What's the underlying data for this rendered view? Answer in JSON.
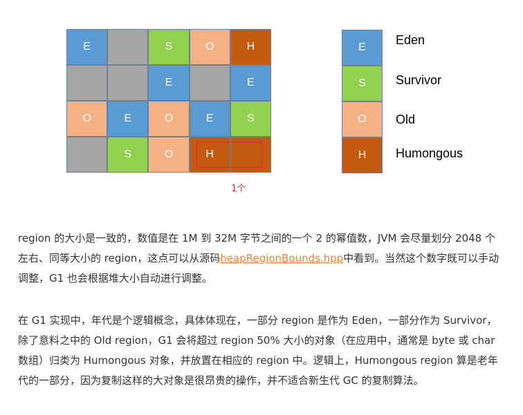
{
  "grid": {
    "rows": [
      [
        "E",
        "",
        "S",
        "O",
        "H"
      ],
      [
        "",
        "",
        "E",
        "",
        "E"
      ],
      [
        "O",
        "E",
        "O",
        "E",
        "S"
      ],
      [
        "",
        "S",
        "O",
        "H",
        ""
      ]
    ],
    "types": [
      [
        "E",
        "G",
        "S",
        "O",
        "H"
      ],
      [
        "G",
        "G",
        "E",
        "G",
        "E"
      ],
      [
        "O",
        "E",
        "O",
        "E",
        "S"
      ],
      [
        "G",
        "S",
        "O",
        "H",
        "H"
      ]
    ]
  },
  "humongous_note": "1个",
  "legend": [
    {
      "code": "E",
      "label": "Eden"
    },
    {
      "code": "S",
      "label": "Survivor"
    },
    {
      "code": "O",
      "label": "Old"
    },
    {
      "code": "H",
      "label": "Humongous"
    }
  ],
  "colors": {
    "eden": "#5b9bd5",
    "survivor": "#92d050",
    "old": "#f4b183",
    "humongous": "#c55a11",
    "free": "#a5a5a5",
    "highlight": "#e53333",
    "link": "#ff7f27"
  },
  "paragraph1": {
    "before": "region 的大小是一致的，数值是在 1M 到 32M 字节之间的一个 2 的幂值数，JVM 会尽量划分 2048 个左右、同等大小的 region，这点可以从源码",
    "link": "heapRegionBounds.hpp",
    "after": "中看到。当然这个数字既可以手动调整，G1 也会根据堆大小自动进行调整。"
  },
  "paragraph2": "在 G1 实现中，年代是个逻辑概念，具体体现在，一部分 region 是作为 Eden，一部分作为 Survivor，除了意料之中的 Old region，G1 会将超过 region 50% 大小的对象（在应用中，通常是 byte 或 char 数组）归类为 Humongous 对象，并放置在相应的 region 中。逻辑上，Humongous region 算是老年代的一部分，因为复制这样的大对象是很昂贵的操作，并不适合新生代 GC 的复制算法。"
}
